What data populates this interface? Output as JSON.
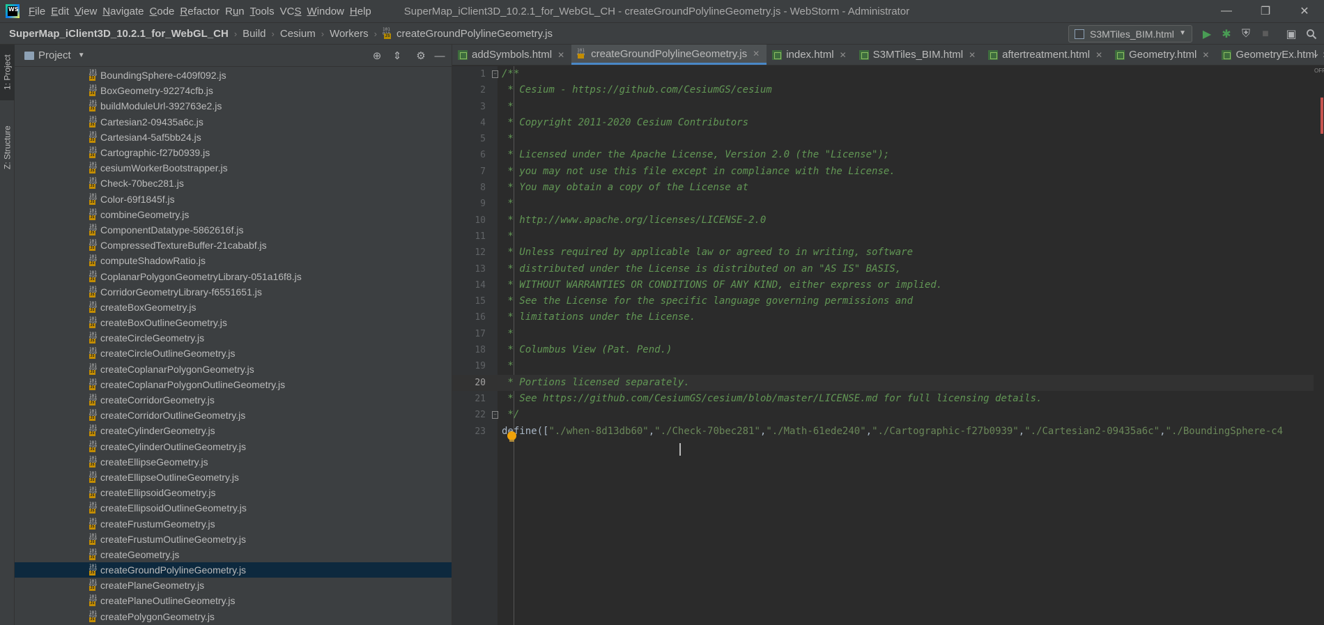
{
  "window": {
    "logo_text": "WS",
    "title": "SuperMap_iClient3D_10.2.1_for_WebGL_CH - createGroundPolylineGeometry.js - WebStorm - Administrator",
    "menu": [
      {
        "label": "File",
        "mnemonic": "F"
      },
      {
        "label": "Edit",
        "mnemonic": "E"
      },
      {
        "label": "View",
        "mnemonic": "V"
      },
      {
        "label": "Navigate",
        "mnemonic": "N"
      },
      {
        "label": "Code",
        "mnemonic": "C"
      },
      {
        "label": "Refactor",
        "mnemonic": "R"
      },
      {
        "label": "Run",
        "mnemonic": "u"
      },
      {
        "label": "Tools",
        "mnemonic": "T"
      },
      {
        "label": "VCS",
        "mnemonic": "S"
      },
      {
        "label": "Window",
        "mnemonic": "W"
      },
      {
        "label": "Help",
        "mnemonic": "H"
      }
    ],
    "controls": {
      "minimize": "—",
      "restore": "❐",
      "close": "✕"
    }
  },
  "navbar": {
    "breadcrumbs": [
      "SuperMap_iClient3D_10.2.1_for_WebGL_CH",
      "Build",
      "Cesium",
      "Workers",
      "createGroundPolylineGeometry.js"
    ],
    "run_config": "S3MTiles_BIM.html",
    "icons": [
      "run-icon",
      "debug-icon",
      "coverage-icon",
      "stop-icon",
      "project-structure-icon",
      "search-icon"
    ],
    "colors": {
      "run": "#499c54",
      "debug": "#499c54"
    }
  },
  "left_strip": {
    "project_tab": "1: Project",
    "structure_tab": "Z: Structure"
  },
  "project_panel": {
    "title": "Project",
    "files": [
      "BoundingSphere-c409f092.js",
      "BoxGeometry-92274cfb.js",
      "buildModuleUrl-392763e2.js",
      "Cartesian2-09435a6c.js",
      "Cartesian4-5af5bb24.js",
      "Cartographic-f27b0939.js",
      "cesiumWorkerBootstrapper.js",
      "Check-70bec281.js",
      "Color-69f1845f.js",
      "combineGeometry.js",
      "ComponentDatatype-5862616f.js",
      "CompressedTextureBuffer-21cababf.js",
      "computeShadowRatio.js",
      "CoplanarPolygonGeometryLibrary-051a16f8.js",
      "CorridorGeometryLibrary-f6551651.js",
      "createBoxGeometry.js",
      "createBoxOutlineGeometry.js",
      "createCircleGeometry.js",
      "createCircleOutlineGeometry.js",
      "createCoplanarPolygonGeometry.js",
      "createCoplanarPolygonOutlineGeometry.js",
      "createCorridorGeometry.js",
      "createCorridorOutlineGeometry.js",
      "createCylinderGeometry.js",
      "createCylinderOutlineGeometry.js",
      "createEllipseGeometry.js",
      "createEllipseOutlineGeometry.js",
      "createEllipsoidGeometry.js",
      "createEllipsoidOutlineGeometry.js",
      "createFrustumGeometry.js",
      "createFrustumOutlineGeometry.js",
      "createGeometry.js",
      "createGroundPolylineGeometry.js",
      "createPlaneGeometry.js",
      "createPlaneOutlineGeometry.js",
      "createPolygonGeometry.js"
    ],
    "selected_file": "createGroundPolylineGeometry.js"
  },
  "editor_tabs": [
    {
      "label": "addSymbols.html",
      "type": "html",
      "active": false
    },
    {
      "label": "createGroundPolylineGeometry.js",
      "type": "js",
      "active": true
    },
    {
      "label": "index.html",
      "type": "html",
      "active": false
    },
    {
      "label": "S3MTiles_BIM.html",
      "type": "html",
      "active": false
    },
    {
      "label": "aftertreatment.html",
      "type": "html",
      "active": false
    },
    {
      "label": "Geometry.html",
      "type": "html",
      "active": false
    },
    {
      "label": "GeometryEx.html",
      "type": "html",
      "active": false
    }
  ],
  "editor": {
    "current_line": 20,
    "lines": [
      {
        "n": "1",
        "text": "/**"
      },
      {
        "n": "2",
        "text": " * Cesium - https://github.com/CesiumGS/cesium"
      },
      {
        "n": "3",
        "text": " *"
      },
      {
        "n": "4",
        "text": " * Copyright 2011-2020 Cesium Contributors"
      },
      {
        "n": "5",
        "text": " *"
      },
      {
        "n": "6",
        "text": " * Licensed under the Apache License, Version 2.0 (the \"License\");"
      },
      {
        "n": "7",
        "text": " * you may not use this file except in compliance with the License."
      },
      {
        "n": "8",
        "text": " * You may obtain a copy of the License at"
      },
      {
        "n": "9",
        "text": " *"
      },
      {
        "n": "10",
        "text": " * http://www.apache.org/licenses/LICENSE-2.0"
      },
      {
        "n": "11",
        "text": " *"
      },
      {
        "n": "12",
        "text": " * Unless required by applicable law or agreed to in writing, software"
      },
      {
        "n": "13",
        "text": " * distributed under the License is distributed on an \"AS IS\" BASIS,"
      },
      {
        "n": "14",
        "text": " * WITHOUT WARRANTIES OR CONDITIONS OF ANY KIND, either express or implied."
      },
      {
        "n": "15",
        "text": " * See the License for the specific language governing permissions and"
      },
      {
        "n": "16",
        "text": " * limitations under the License."
      },
      {
        "n": "17",
        "text": " *"
      },
      {
        "n": "18",
        "text": " * Columbus View (Pat. Pend.)"
      },
      {
        "n": "19",
        "text": " *"
      },
      {
        "n": "20",
        "text": " * Portions licensed separately."
      },
      {
        "n": "21",
        "text": " * See https://github.com/CesiumGS/cesium/blob/master/LICENSE.md for full licensing details."
      },
      {
        "n": "22",
        "text": " */"
      },
      {
        "n": "23",
        "text": ""
      }
    ],
    "define_line": {
      "prefix": "define([",
      "strings": [
        "\"./when-8d13db60\"",
        "\"./Check-70bec281\"",
        "\"./Math-61ede240\"",
        "\"./Cartographic-f27b0939\"",
        "\"./Cartesian2-09435a6c\"",
        "\"./BoundingSphere-c4"
      ]
    },
    "inspection_widget": "OFF",
    "colors": {
      "comment": "#629755",
      "string": "#6a8759",
      "code": "#a9b7c6",
      "error_stripe": "#c75450"
    }
  }
}
